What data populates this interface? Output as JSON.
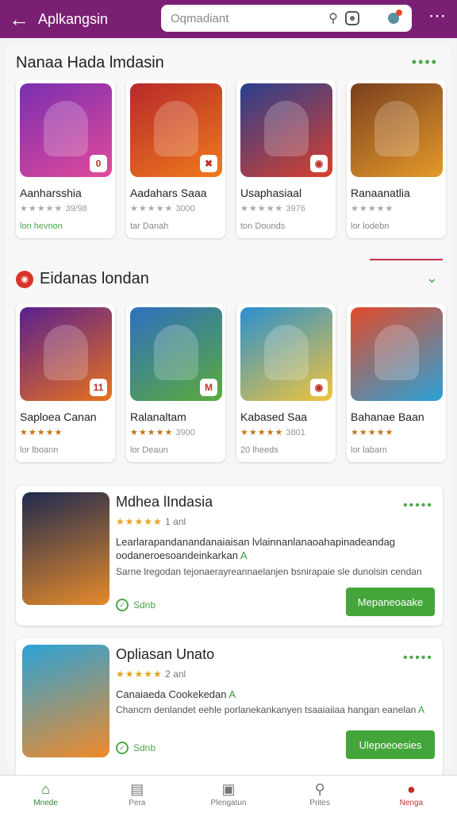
{
  "header": {
    "title": "Aplkangsin",
    "search_placeholder": "Oqmadiant",
    "search_icon": "search-icon",
    "emoji_icon": "emoji-icon",
    "notification_icon": "notification-icon",
    "more_icon": "more-vertical-icon"
  },
  "section1": {
    "title": "Nanaa Hada lmdasin",
    "items": [
      {
        "name": "Aanharsshia",
        "rating": "39/98",
        "meta": "lon hevnon",
        "meta_green": true,
        "badge": "0",
        "colors": [
          "#7a2fb0",
          "#e24a9a"
        ]
      },
      {
        "name": "Aadahars Saaa",
        "rating": "3000",
        "meta": "tar Danah",
        "meta_green": false,
        "badge": "✖",
        "colors": [
          "#b6292a",
          "#f07a1c"
        ]
      },
      {
        "name": "Usaphasiaal",
        "rating": "3976",
        "meta": "ton Dounds",
        "meta_green": false,
        "badge": "◉",
        "colors": [
          "#2a3f8f",
          "#d8412c"
        ]
      },
      {
        "name": "Ranaanatlia",
        "rating": "",
        "meta": "lor lodebn",
        "meta_green": false,
        "badge": "",
        "colors": [
          "#7a3f1f",
          "#e59a2a"
        ]
      }
    ]
  },
  "section2": {
    "title": "Eidanas londan",
    "icon": "game-badge-icon",
    "items": [
      {
        "name": "Saploea Canan",
        "rating": "",
        "meta": "lor lboann",
        "badge": "11",
        "colors": [
          "#5a1f8f",
          "#e8731c"
        ]
      },
      {
        "name": "Ralanaltam",
        "rating": "3900",
        "meta": "lor Deaun",
        "badge": "M",
        "colors": [
          "#2f6fc0",
          "#5bab3a"
        ]
      },
      {
        "name": "Kabased Saa",
        "rating": "3801",
        "meta": "20 lheeds",
        "badge": "◉",
        "colors": [
          "#2a8fd0",
          "#f2c53c"
        ]
      },
      {
        "name": "Bahanae Baan",
        "rating": "",
        "meta": "lor labarn",
        "badge": "",
        "colors": [
          "#e24a2a",
          "#2aa3d8"
        ]
      }
    ]
  },
  "featured": [
    {
      "title": "Mdhea lIndasia",
      "rating_text": "1 anl",
      "desc": "Learlarapandanandanaiaisan lvlainnanlanaoahapinadeandag oodaneroesoandeinkarkan",
      "desc_mark": "A",
      "sub": "Sarne lregodan tejonaerayreannaelanjen bsnirapaie sle dunolsin cendan",
      "status": "Sdnb",
      "button": "Mepaneoaake",
      "colors": [
        "#1f2a4f",
        "#e58a2a"
      ]
    },
    {
      "title": "Opliasan Unato",
      "rating_text": "2 anl",
      "desc": "Canaiaeda Cookekedan",
      "desc_mark": "A",
      "sub": "Chancm denlandet eehle porlanekankanyen tsaaiaiiaa hangan eanelan",
      "sub_mark": "A",
      "status": "Sdnb",
      "button": "Ulepoeoesies",
      "colors": [
        "#2aa3d8",
        "#f08a2a"
      ]
    }
  ],
  "nav": [
    {
      "label": "Mnede",
      "icon": "home-icon",
      "glyph": "⌂"
    },
    {
      "label": "Pera",
      "icon": "store-icon",
      "glyph": "▤"
    },
    {
      "label": "Plengatun",
      "icon": "games-icon",
      "glyph": "▣"
    },
    {
      "label": "Prites",
      "icon": "search-icon",
      "glyph": "⚲"
    },
    {
      "label": "Nenga",
      "icon": "profile-icon",
      "glyph": "●"
    }
  ],
  "colors": {
    "topbar": "#7b1f74",
    "accent_green": "#43a53a",
    "accent_red": "#c0302a"
  }
}
